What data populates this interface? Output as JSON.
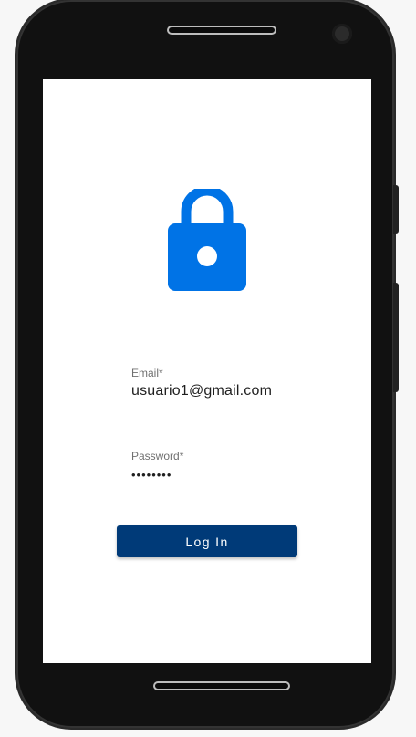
{
  "login": {
    "email_label": "Email*",
    "email_value": "usuario1@gmail.com",
    "password_label": "Password*",
    "password_value": "••••••••",
    "button_label": "Log In"
  },
  "icons": {
    "hero": "lock-icon"
  },
  "colors": {
    "accent": "#0073e6",
    "button": "#003a78"
  }
}
